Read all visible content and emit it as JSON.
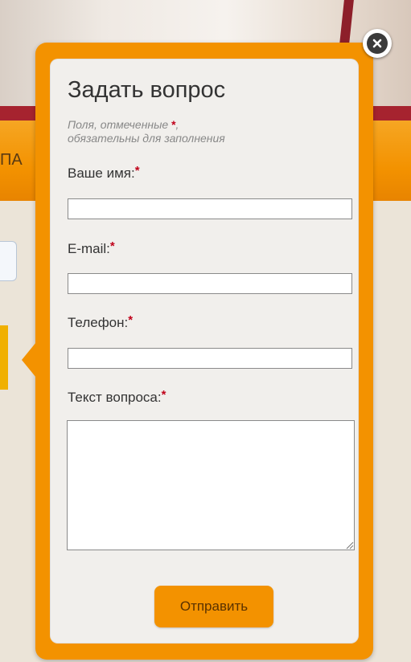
{
  "background": {
    "nav_partial_text": "ПА"
  },
  "modal": {
    "title": "Задать вопрос",
    "hint_line1": "Поля, отмеченные ",
    "hint_star": "*",
    "hint_comma": ",",
    "hint_line2": "обязательны для заполнения",
    "required_mark": "*",
    "fields": [
      {
        "label": "Ваше имя:",
        "value": "",
        "placeholder": ""
      },
      {
        "label": "E-mail:",
        "value": "",
        "placeholder": ""
      },
      {
        "label": "Телефон:",
        "value": "",
        "placeholder": ""
      },
      {
        "label": "Текст вопроса:",
        "value": "",
        "placeholder": ""
      }
    ],
    "submit_label": "Отправить",
    "close_icon": "close-icon"
  },
  "colors": {
    "accent": "#f39200",
    "required": "#c0001a",
    "panel": "#f1efec"
  }
}
